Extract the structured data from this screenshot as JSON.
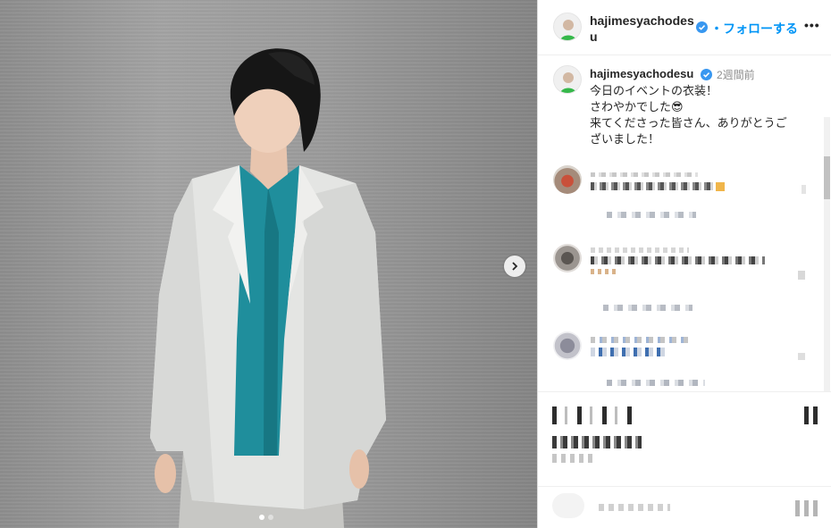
{
  "post": {
    "username": "hajimesyachodesu",
    "username_line1": "hajimesyachodes",
    "username_line2": "u",
    "follow_label": "・フォローする",
    "more_label": "•••",
    "caption": {
      "username": "hajimesyachodesu",
      "time": "2週間前",
      "lines": [
        "今日のイベントの衣装！",
        "さわやかでした😎",
        "来てくださった皆さん、ありがとうご",
        "ざいました！"
      ]
    }
  },
  "carousel": {
    "slide_count": 2,
    "active_index": 0
  },
  "colors": {
    "accent": "#0095f6",
    "verified": "#3897f0",
    "shirt": "#1f8e9c",
    "coat": "#e4e5e3"
  },
  "icons": [
    "verified-badge-icon",
    "more-options-icon",
    "chevron-right-icon",
    "avatar-icon"
  ]
}
